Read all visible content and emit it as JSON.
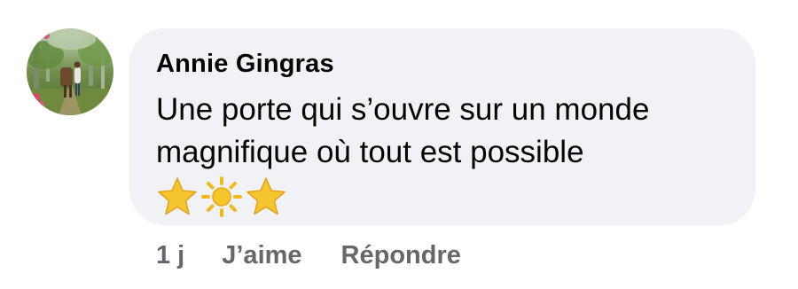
{
  "comment": {
    "author": "Annie Gingras",
    "text_line1": "Une porte qui s’ouvre sur un monde",
    "text_line2": "magnifique où tout est possible",
    "emojis": [
      "star-emoji",
      "sun-emoji",
      "star-emoji"
    ]
  },
  "actions": {
    "time": "1 j",
    "like_label": "J’aime",
    "reply_label": "Répondre"
  },
  "colors": {
    "bubble_bg": "#f0f2f5",
    "text": "#050505",
    "muted": "#65676b",
    "star": "#f6c42d",
    "sun": "#f5b819"
  }
}
